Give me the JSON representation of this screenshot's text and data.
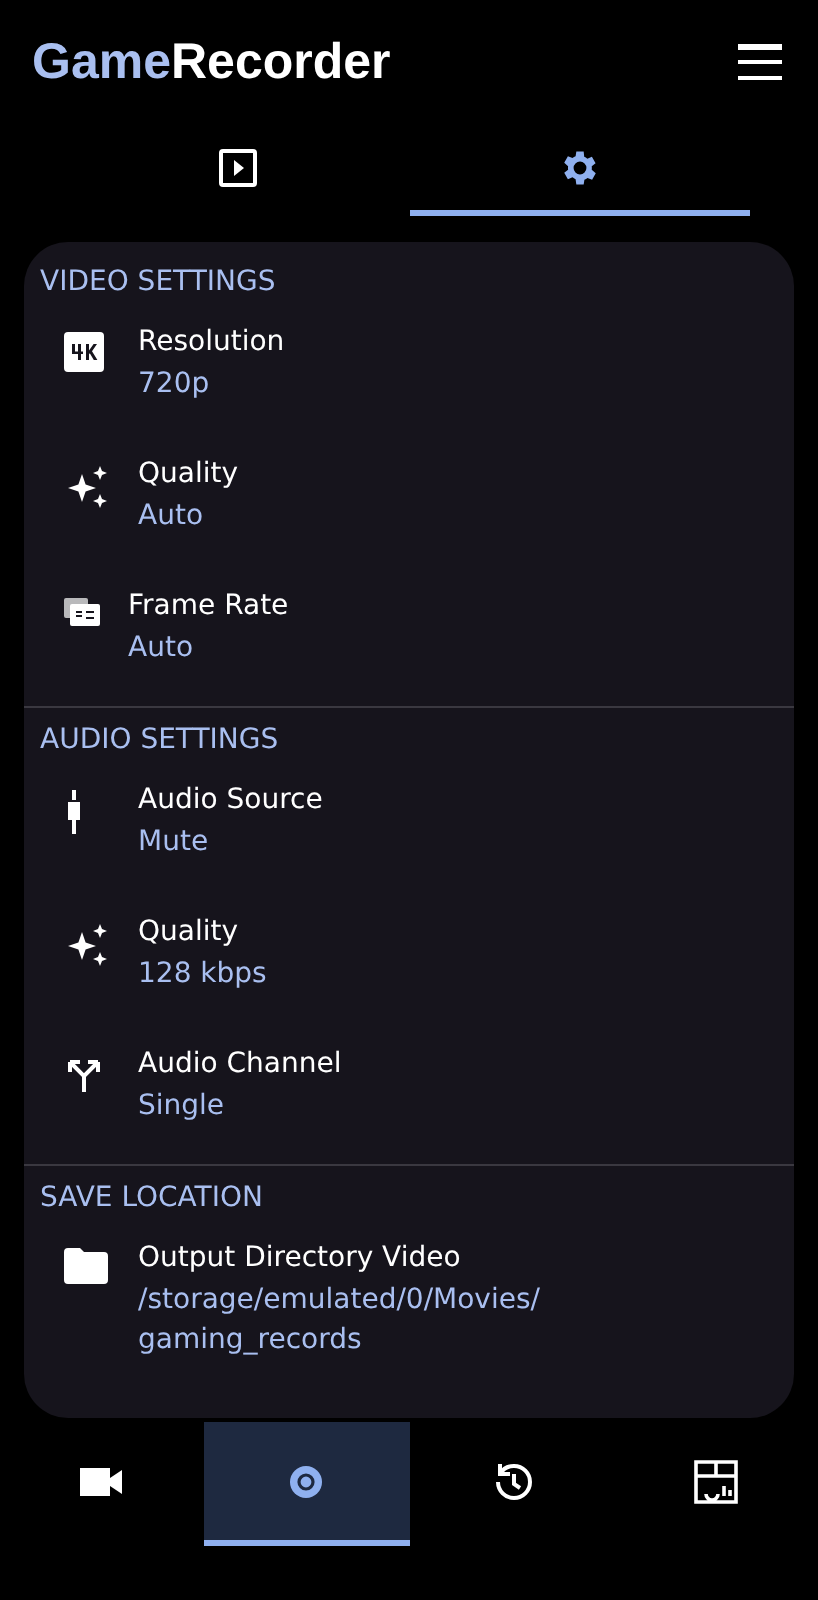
{
  "app_title": {
    "accent": "Game",
    "rest": "Recorder"
  },
  "tabs": [
    {
      "kind": "play",
      "selected": false
    },
    {
      "kind": "gear",
      "selected": true
    }
  ],
  "sections": [
    {
      "title": "VIDEO SETTINGS",
      "items": [
        {
          "kind": "resolution",
          "label": "Resolution",
          "value": "720p"
        },
        {
          "kind": "sparkle",
          "label": "Quality",
          "value": "Auto"
        },
        {
          "kind": "fps",
          "label": "Frame Rate",
          "value": "Auto"
        }
      ]
    },
    {
      "title": "AUDIO SETTINGS",
      "items": [
        {
          "kind": "mic",
          "label": "Audio Source",
          "value": "Mute"
        },
        {
          "kind": "sparkle",
          "label": "Quality",
          "value": "128 kbps"
        },
        {
          "kind": "split",
          "label": "Audio Channel",
          "value": "Single"
        }
      ]
    },
    {
      "title": "SAVE LOCATION",
      "items": [
        {
          "kind": "folder",
          "label": "Output Directory Video",
          "value": "/storage/emulated/0/Movies/\ngaming_records"
        }
      ]
    }
  ],
  "bottom_nav": [
    {
      "kind": "video",
      "selected": false
    },
    {
      "kind": "badge",
      "selected": true
    },
    {
      "kind": "history",
      "selected": false
    },
    {
      "kind": "dashboard",
      "selected": false
    }
  ]
}
